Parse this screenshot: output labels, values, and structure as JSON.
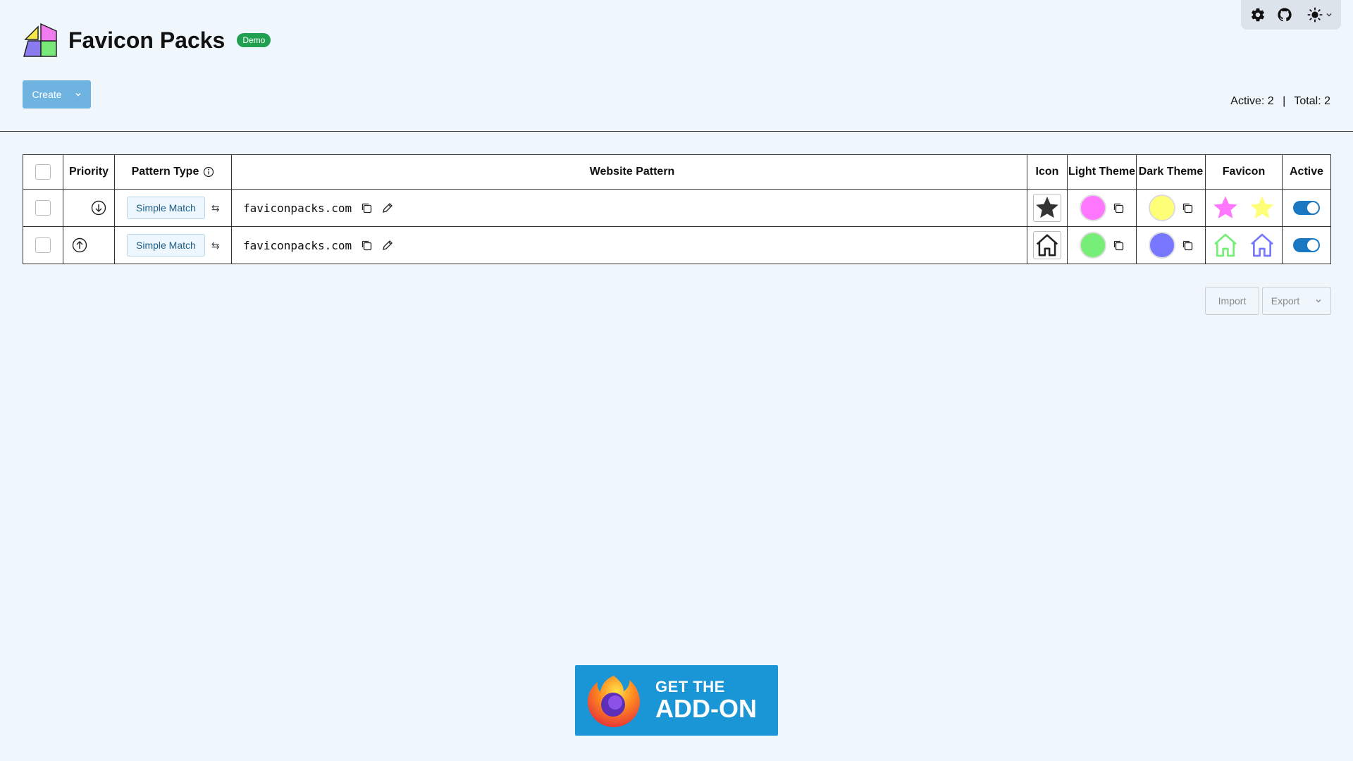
{
  "app": {
    "title": "Favicon Packs",
    "badge": "Demo"
  },
  "toolbar": {
    "settings_icon": "gear-icon",
    "github_icon": "github-icon",
    "theme_icon": "sun-icon"
  },
  "actions": {
    "create_label": "Create",
    "import_label": "Import",
    "export_label": "Export"
  },
  "counts": {
    "active_text": "Active: 2",
    "separator": "|",
    "total_text": "Total: 2"
  },
  "table": {
    "headers": {
      "priority": "Priority",
      "pattern_type": "Pattern Type",
      "website_pattern": "Website Pattern",
      "icon": "Icon",
      "light_theme": "Light Theme",
      "dark_theme": "Dark Theme",
      "favicon": "Favicon",
      "active": "Active"
    },
    "rows": [
      {
        "priority_icon": "arrow-down-circle-icon",
        "pattern_type": "Simple Match",
        "pattern": "faviconpacks.com",
        "icon": "star-icon",
        "light_color": "#ff77ff",
        "dark_color": "#ffff77",
        "active": true
      },
      {
        "priority_icon": "arrow-up-circle-icon",
        "pattern_type": "Simple Match",
        "pattern": "faviconpacks.com",
        "icon": "house-icon",
        "light_color": "#77ee77",
        "dark_color": "#7777ff",
        "active": true
      }
    ]
  },
  "addon": {
    "line1": "GET THE",
    "line2": "ADD-ON"
  }
}
